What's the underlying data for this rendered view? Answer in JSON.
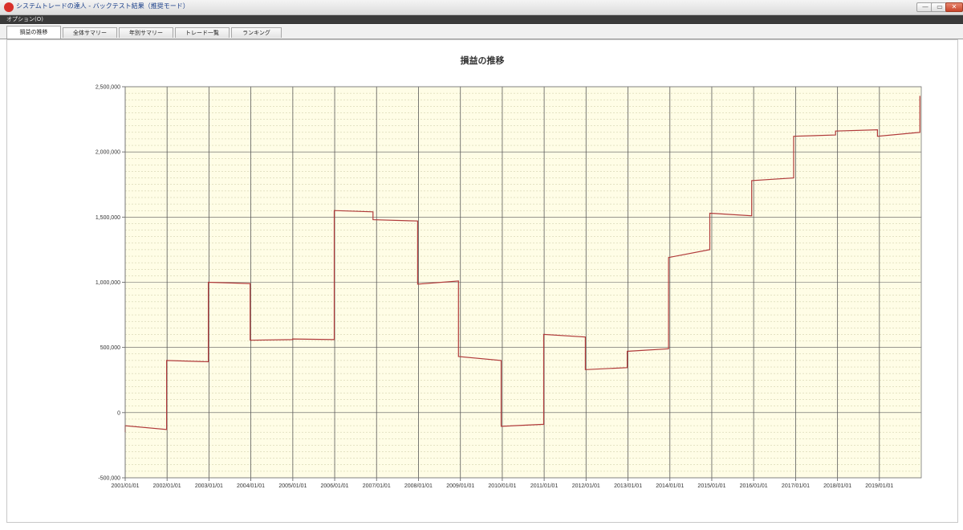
{
  "window": {
    "title": "システムトレードの達人 - バックテスト結果（推奨モード）",
    "minimize_glyph": "—",
    "maximize_glyph": "▭",
    "close_glyph": "✕"
  },
  "menu": {
    "options_label": "オプション(O)"
  },
  "tabs": [
    {
      "label": "損益の推移",
      "active": true
    },
    {
      "label": "全体サマリー",
      "active": false
    },
    {
      "label": "年別サマリー",
      "active": false
    },
    {
      "label": "トレード一覧",
      "active": false
    },
    {
      "label": "ランキング",
      "active": false
    }
  ],
  "colors": {
    "plot_background": "#fffde6",
    "series_line": "#b03a3a",
    "major_grid": "#5a5a5a",
    "minor_grid": "#c8c8a0"
  },
  "chart_data": {
    "type": "line",
    "title": "損益の推移",
    "xlabel": "",
    "ylabel": "",
    "grid": true,
    "legend": "none",
    "ylim": [
      -500000,
      2500000
    ],
    "xlim": [
      "2001/01/01",
      "2020/01/01"
    ],
    "y_ticks": [
      -500000,
      0,
      500000,
      1000000,
      1500000,
      2000000,
      2500000
    ],
    "y_tick_labels": [
      "-500,000",
      "0",
      "500,000",
      "1,000,000",
      "1,500,000",
      "2,000,000",
      "2,500,000"
    ],
    "x_tick_labels": [
      "2001/01/01",
      "2002/01/01",
      "2003/01/01",
      "2004/01/01",
      "2005/01/01",
      "2006/01/01",
      "2007/01/01",
      "2008/01/01",
      "2009/01/01",
      "2010/01/01",
      "2011/01/01",
      "2012/01/01",
      "2013/01/01",
      "2014/01/01",
      "2015/01/01",
      "2016/01/01",
      "2017/01/01",
      "2018/01/01",
      "2019/01/01"
    ],
    "series": [
      {
        "points": [
          {
            "x": "2001/01/01",
            "y": -150000
          },
          {
            "x": "2001/01/01",
            "y": -100000
          },
          {
            "x": "2001/12/28",
            "y": -130000
          },
          {
            "x": "2001/12/28",
            "y": 400000
          },
          {
            "x": "2002/12/27",
            "y": 390000
          },
          {
            "x": "2002/12/27",
            "y": 1000000
          },
          {
            "x": "2003/12/26",
            "y": 990000
          },
          {
            "x": "2003/12/26",
            "y": 555000
          },
          {
            "x": "2004/12/30",
            "y": 560000
          },
          {
            "x": "2004/12/30",
            "y": 565000
          },
          {
            "x": "2005/12/28",
            "y": 560000
          },
          {
            "x": "2005/12/28",
            "y": 1550000
          },
          {
            "x": "2006/12/01",
            "y": 1540000
          },
          {
            "x": "2006/12/01",
            "y": 1480000
          },
          {
            "x": "2007/12/25",
            "y": 1470000
          },
          {
            "x": "2007/12/25",
            "y": 985000
          },
          {
            "x": "2008/12/15",
            "y": 1010000
          },
          {
            "x": "2008/12/15",
            "y": 430000
          },
          {
            "x": "2009/12/22",
            "y": 400000
          },
          {
            "x": "2009/12/22",
            "y": -105000
          },
          {
            "x": "2010/12/28",
            "y": -90000
          },
          {
            "x": "2010/12/28",
            "y": 600000
          },
          {
            "x": "2011/12/26",
            "y": 580000
          },
          {
            "x": "2011/12/26",
            "y": 330000
          },
          {
            "x": "2012/12/25",
            "y": 345000
          },
          {
            "x": "2012/12/25",
            "y": 470000
          },
          {
            "x": "2013/12/20",
            "y": 490000
          },
          {
            "x": "2013/12/20",
            "y": 1190000
          },
          {
            "x": "2014/12/15",
            "y": 1250000
          },
          {
            "x": "2014/12/15",
            "y": 1530000
          },
          {
            "x": "2015/12/15",
            "y": 1510000
          },
          {
            "x": "2015/12/15",
            "y": 1780000
          },
          {
            "x": "2016/12/15",
            "y": 1800000
          },
          {
            "x": "2016/12/15",
            "y": 2120000
          },
          {
            "x": "2017/12/15",
            "y": 2130000
          },
          {
            "x": "2017/12/15",
            "y": 2160000
          },
          {
            "x": "2018/12/15",
            "y": 2170000
          },
          {
            "x": "2018/12/15",
            "y": 2120000
          },
          {
            "x": "2019/12/20",
            "y": 2150000
          },
          {
            "x": "2019/12/20",
            "y": 2430000
          }
        ]
      }
    ]
  }
}
